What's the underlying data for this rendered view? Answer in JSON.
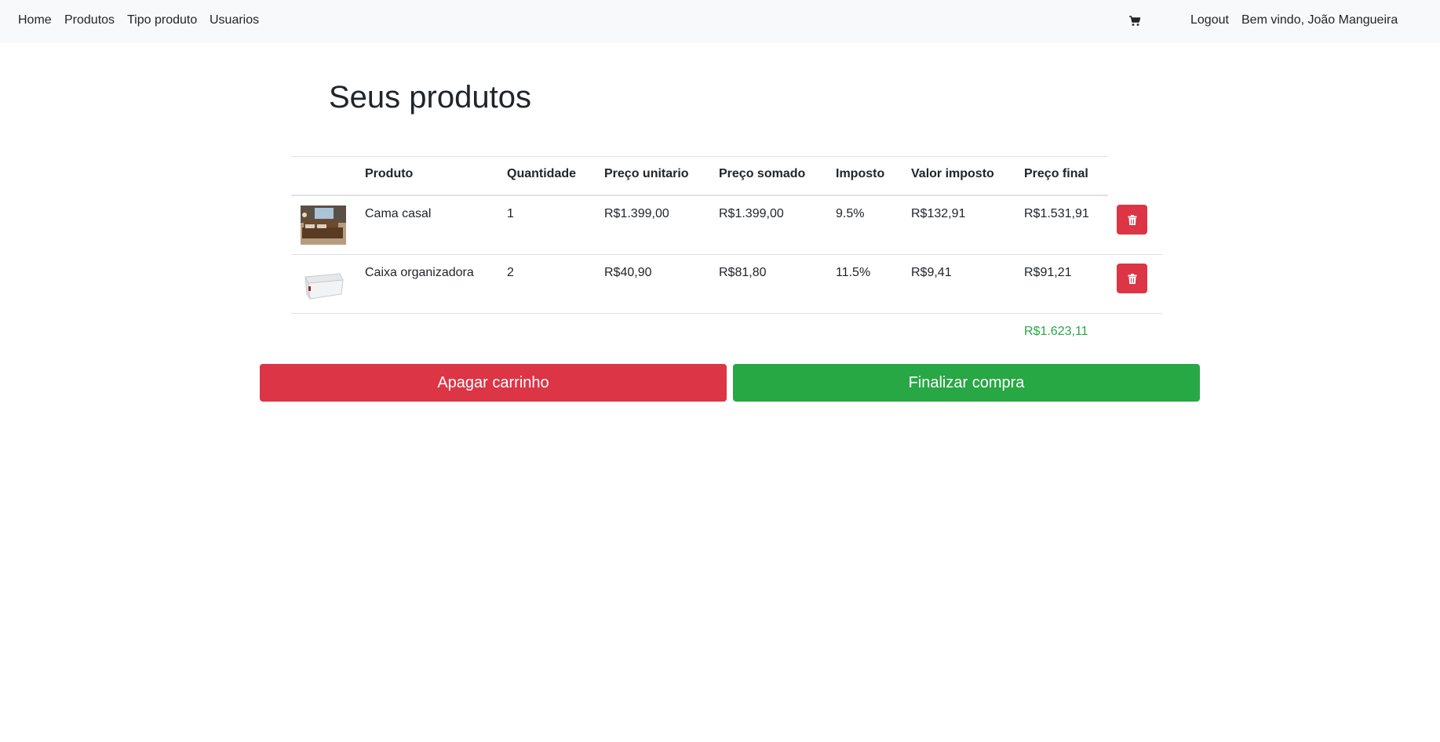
{
  "nav": {
    "items": [
      "Home",
      "Produtos",
      "Tipo produto",
      "Usuarios"
    ],
    "cart_icon": "cart-icon",
    "logout": "Logout",
    "welcome": "Bem vindo, João Mangueira"
  },
  "page": {
    "title": "Seus produtos"
  },
  "table": {
    "headers": [
      "",
      "Produto",
      "Quantidade",
      "Preço unitario",
      "Preço somado",
      "Imposto",
      "Valor imposto",
      "Preço final",
      ""
    ],
    "rows": [
      {
        "image": "bed-thumbnail",
        "produto": "Cama casal",
        "quantidade": "1",
        "preco_unitario": "R$1.399,00",
        "preco_somado": "R$1.399,00",
        "imposto": "9.5%",
        "valor_imposto": "R$132,91",
        "preco_final": "R$1.531,91",
        "delete_icon": "trash-icon"
      },
      {
        "image": "storage-box-thumbnail",
        "produto": "Caixa organizadora",
        "quantidade": "2",
        "preco_unitario": "R$40,90",
        "preco_somado": "R$81,80",
        "imposto": "11.5%",
        "valor_imposto": "R$9,41",
        "preco_final": "R$91,21",
        "delete_icon": "trash-icon"
      }
    ],
    "total": "R$1.623,11"
  },
  "actions": {
    "clear_cart": "Apagar carrinho",
    "checkout": "Finalizar compra"
  },
  "colors": {
    "navbar_bg": "#f8f9fa",
    "danger": "#dc3545",
    "success": "#28a745",
    "text": "#212529",
    "border": "#dee2e6"
  }
}
